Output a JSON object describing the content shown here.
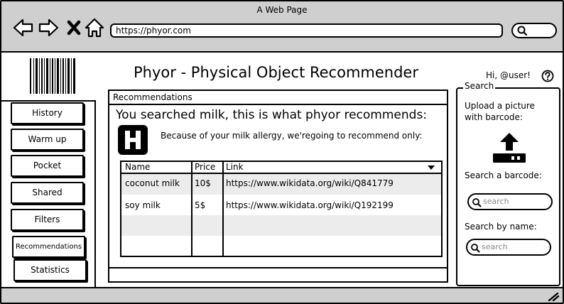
{
  "window": {
    "title": "A Web Page",
    "url": "https://phyor.com"
  },
  "header": {
    "app_title": "Phyor - Physical Object Recommender",
    "greeting": "Hi, @user!"
  },
  "sidebar": {
    "items": [
      {
        "label": "History"
      },
      {
        "label": "Warm up"
      },
      {
        "label": "Pocket"
      },
      {
        "label": "Shared"
      },
      {
        "label": "Filters"
      },
      {
        "label": "Recommendations"
      },
      {
        "label": "Statistics"
      }
    ]
  },
  "recommendations": {
    "panel_title": "Recommendations",
    "message": "You searched milk, this is what phyor recommends:",
    "subtitle": "Because of your milk allergy, we'regoing to recommend only:",
    "table": {
      "columns": [
        "Name",
        "Price",
        "Link"
      ],
      "rows": [
        [
          "coconut milk",
          "10$",
          "https://www.wikidata.org/wiki/Q841779"
        ],
        [
          "soy milk",
          "5$",
          "https://www.wikidata.org/wiki/Q192199"
        ]
      ]
    }
  },
  "search": {
    "title": "Search",
    "upload_label": "Upload a picture with barcode:",
    "barcode_label": "Search a barcode:",
    "barcode_placeholder": "search",
    "name_label": "Search by name:",
    "name_placeholder": "search"
  },
  "icons": [
    "back-icon",
    "forward-icon",
    "close-icon",
    "home-icon",
    "search-icon",
    "barcode-icon",
    "help-icon",
    "h-icon",
    "upload-icon",
    "sort-down-icon",
    "resize-grip-icon"
  ]
}
